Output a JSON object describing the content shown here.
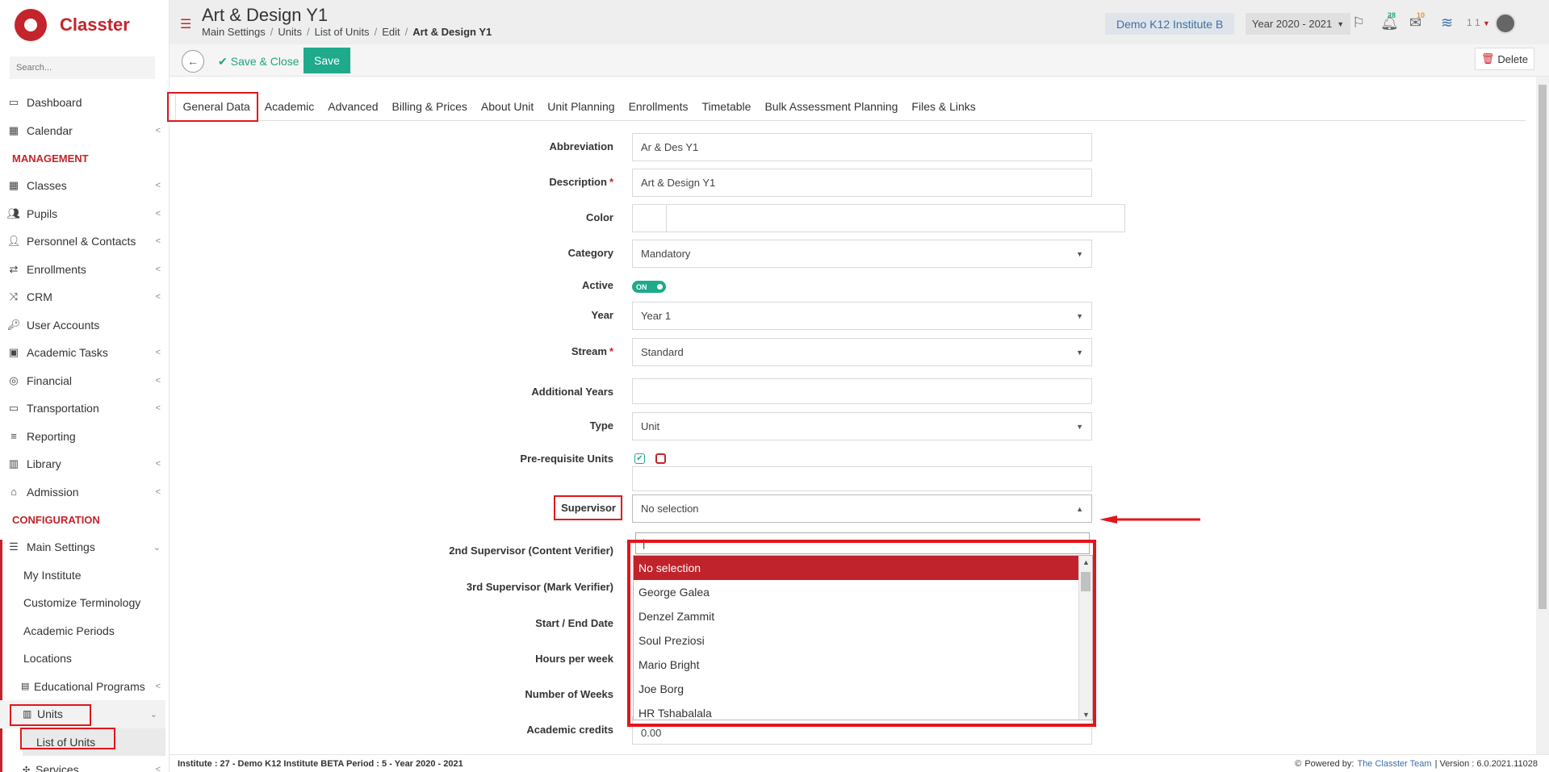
{
  "app": {
    "brand": "Classter",
    "search_placeholder": "Search..."
  },
  "sidebar": {
    "items_top": [
      {
        "label": "Dashboard",
        "icon": "laptop-icon"
      },
      {
        "label": "Calendar",
        "icon": "calendar-icon",
        "chevron": "<"
      }
    ],
    "management_title": "MANAGEMENT",
    "management_items": [
      {
        "label": "Classes",
        "icon": "classes-icon",
        "chevron": "<"
      },
      {
        "label": "Pupils",
        "icon": "pupils-icon",
        "chevron": "<"
      },
      {
        "label": "Personnel & Contacts",
        "icon": "person-icon",
        "chevron": "<"
      },
      {
        "label": "Enrollments",
        "icon": "exchange-icon",
        "chevron": "<"
      },
      {
        "label": "CRM",
        "icon": "shuffle-icon",
        "chevron": "<"
      },
      {
        "label": "User Accounts",
        "icon": "key-icon",
        "chevron": ""
      },
      {
        "label": "Academic Tasks",
        "icon": "grid-icon",
        "chevron": "<"
      },
      {
        "label": "Financial",
        "icon": "coins-icon",
        "chevron": "<"
      },
      {
        "label": "Transportation",
        "icon": "bus-icon",
        "chevron": "<"
      },
      {
        "label": "Reporting",
        "icon": "stack-icon",
        "chevron": ""
      },
      {
        "label": "Library",
        "icon": "library-icon",
        "chevron": "<"
      },
      {
        "label": "Admission",
        "icon": "bank-icon",
        "chevron": "<"
      }
    ],
    "config_title": "CONFIGURATION",
    "main_settings": "Main Settings",
    "config_sub": [
      "My Institute",
      "Customize Terminology",
      "Academic Periods",
      "Locations"
    ],
    "educational_programs": "Educational Programs",
    "units": "Units",
    "list_of_units": "List of Units",
    "services": "Services"
  },
  "header": {
    "title": "Art & Design Y1",
    "breadcrumb": [
      "Main Settings",
      "Units",
      "List of Units",
      "Edit",
      "Art & Design Y1"
    ],
    "institute": "Demo K12 Institute B",
    "year": "Year 2020 - 2021",
    "notif_count": "28",
    "mail_count": "10",
    "user_count": "1 1"
  },
  "toolbar": {
    "save_close": "Save & Close",
    "save": "Save",
    "delete": "Delete"
  },
  "tabs": [
    "General Data",
    "Academic",
    "Advanced",
    "Billing & Prices",
    "About Unit",
    "Unit Planning",
    "Enrollments",
    "Timetable",
    "Bulk Assessment Planning",
    "Files & Links"
  ],
  "form": {
    "abbreviation": {
      "label": "Abbreviation",
      "value": "Ar & Des Y1"
    },
    "description": {
      "label": "Description",
      "value": "Art & Design Y1"
    },
    "color": {
      "label": "Color"
    },
    "category": {
      "label": "Category",
      "value": "Mandatory"
    },
    "active": {
      "label": "Active",
      "value": "ON"
    },
    "year": {
      "label": "Year",
      "value": "Year 1"
    },
    "stream": {
      "label": "Stream",
      "value": "Standard"
    },
    "additional_years": {
      "label": "Additional Years"
    },
    "type": {
      "label": "Type",
      "value": "Unit"
    },
    "prereq": {
      "label": "Pre-requisite Units"
    },
    "supervisor": {
      "label": "Supervisor",
      "value": "No selection"
    },
    "supervisor2": {
      "label": "2nd Supervisor (Content Verifier)"
    },
    "supervisor3": {
      "label": "3rd Supervisor (Mark Verifier)"
    },
    "start_end": {
      "label": "Start / End Date"
    },
    "hours": {
      "label": "Hours per week"
    },
    "weeks": {
      "label": "Number of Weeks"
    },
    "credits": {
      "label": "Academic credits",
      "value": "0.00"
    }
  },
  "dropdown": {
    "search_value": "|",
    "options": [
      "No selection",
      "George Galea",
      "Denzel Zammit",
      "Soul Preziosi",
      "Mario Bright",
      "Joe Borg",
      "HR Tshabalala"
    ]
  },
  "footer": {
    "left": "Institute : 27 - Demo K12 Institute BETA Period : 5 - Year 2020 - 2021",
    "powered": "Powered by:",
    "team": "The Classter Team",
    "version": "| Version : 6.0.2021.11028"
  },
  "colors": {
    "brand": "#c4242b",
    "accent": "#1eaa8b",
    "highlight": "#e3151d"
  }
}
